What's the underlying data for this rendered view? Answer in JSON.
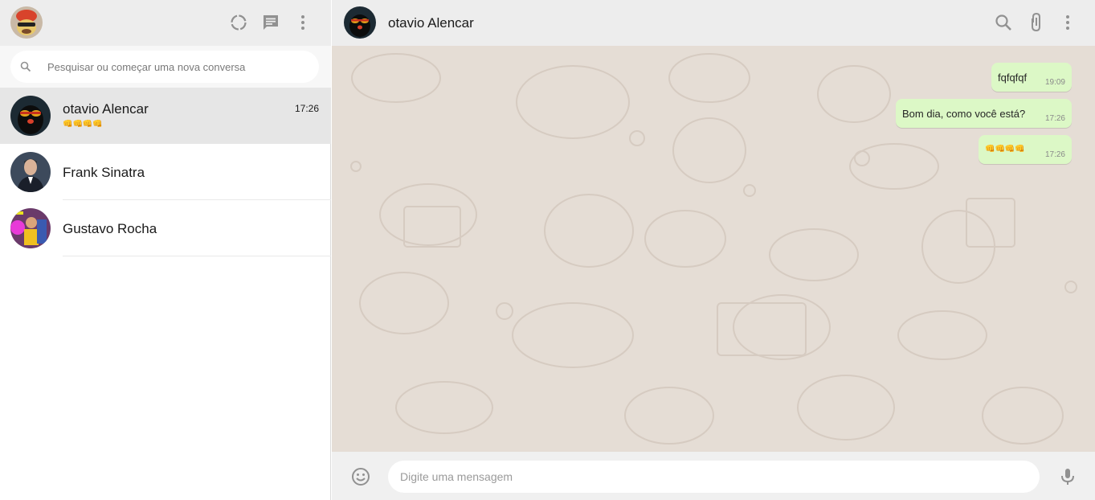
{
  "sidebar": {
    "header": {
      "my_avatar_label": "profile-photo",
      "icons": [
        "status-icon",
        "new-chat-icon",
        "menu-icon"
      ]
    },
    "search": {
      "placeholder": "Pesquisar ou começar uma nova conversa"
    },
    "chats": [
      {
        "name": "otavio Alencar",
        "time": "17:26",
        "preview": "👊👊👊👊",
        "active": true
      },
      {
        "name": "Frank Sinatra",
        "time": "",
        "preview": "",
        "active": false
      },
      {
        "name": "Gustavo Rocha",
        "time": "",
        "preview": "",
        "active": false
      }
    ]
  },
  "main": {
    "header": {
      "title": "otavio Alencar",
      "icons": [
        "search-icon",
        "attach-icon",
        "menu-icon"
      ]
    },
    "messages": [
      {
        "text": "fqfqfqf",
        "time": "19:09",
        "direction": "outgoing"
      },
      {
        "text": "Bom dia, como você está?",
        "time": "17:26",
        "direction": "outgoing"
      },
      {
        "text": "👊👊👊👊",
        "time": "17:26",
        "direction": "outgoing"
      }
    ],
    "composer": {
      "placeholder": "Digite uma mensagem"
    }
  },
  "colors": {
    "header_bg": "#ededed",
    "active_chat_bg": "#e6e6e6",
    "conversation_bg": "#e5ddd5",
    "outgoing_bubble": "#dcf8c6",
    "icon_gray": "#919191"
  }
}
